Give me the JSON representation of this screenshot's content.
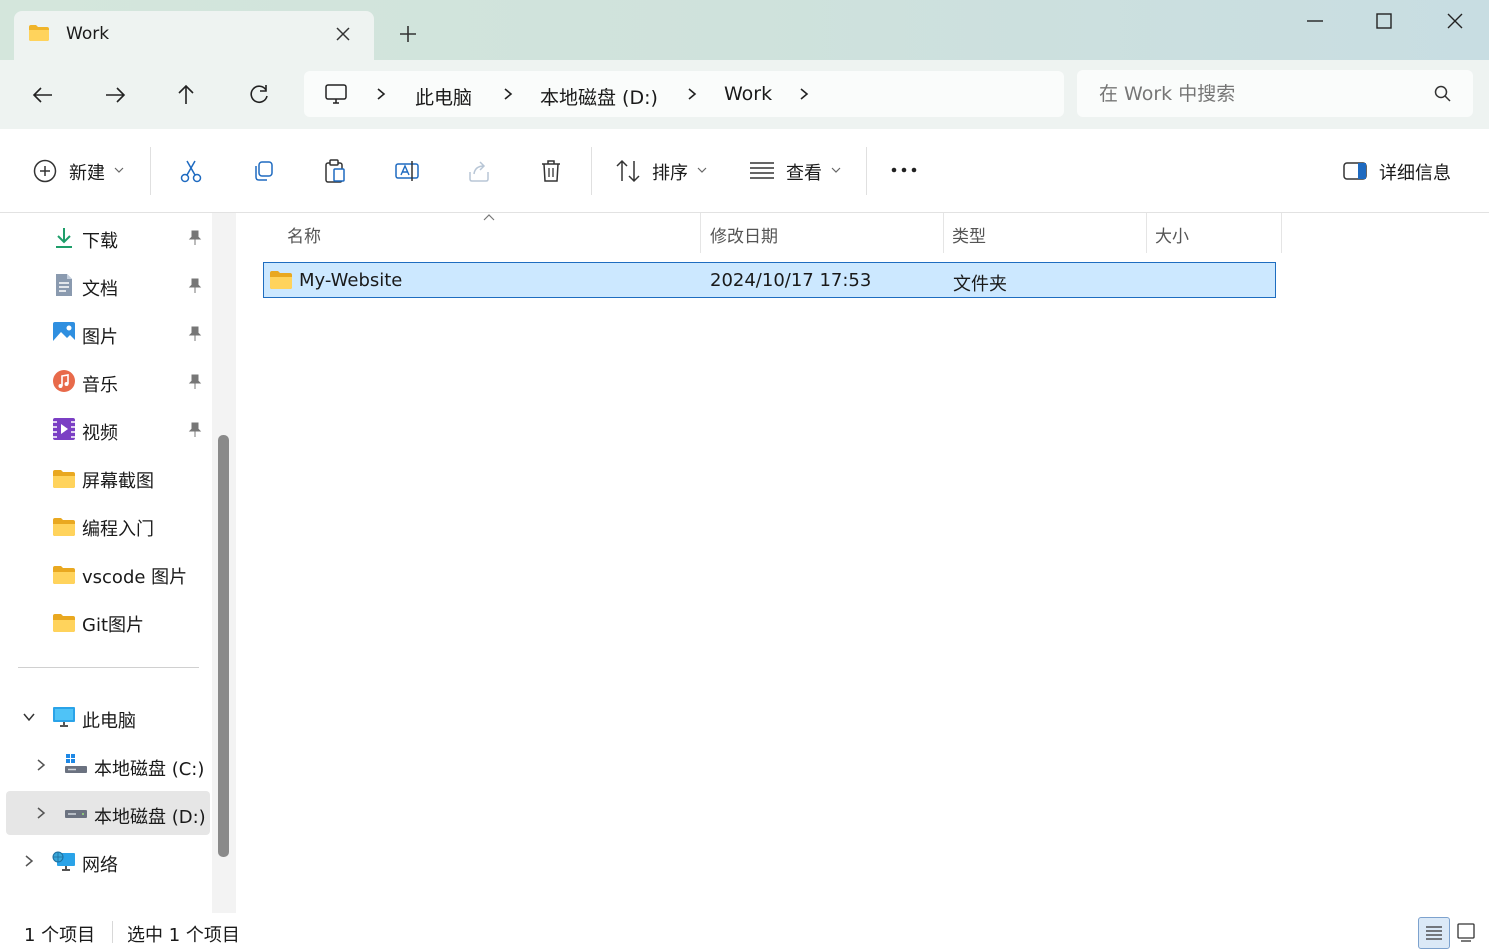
{
  "tab": {
    "title": "Work"
  },
  "address": {
    "crumbs": [
      "此电脑",
      "本地磁盘 (D:)",
      "Work"
    ]
  },
  "search": {
    "placeholder": "在 Work 中搜索"
  },
  "toolbar": {
    "new_label": "新建",
    "sort_label": "排序",
    "view_label": "查看",
    "details_label": "详细信息"
  },
  "sidebar": {
    "quick_access": [
      {
        "label": "下载",
        "icon": "download-icon",
        "pinned": true
      },
      {
        "label": "文档",
        "icon": "document-icon",
        "pinned": true
      },
      {
        "label": "图片",
        "icon": "pictures-icon",
        "pinned": true
      },
      {
        "label": "音乐",
        "icon": "music-icon",
        "pinned": true
      },
      {
        "label": "视频",
        "icon": "video-icon",
        "pinned": true
      },
      {
        "label": "屏幕截图",
        "icon": "folder-icon",
        "pinned": false
      },
      {
        "label": "编程入门",
        "icon": "folder-icon",
        "pinned": false
      },
      {
        "label": "vscode 图片",
        "icon": "folder-icon",
        "pinned": false
      },
      {
        "label": "Git图片",
        "icon": "folder-icon",
        "pinned": false
      }
    ],
    "this_pc": {
      "label": "此电脑",
      "expanded": true
    },
    "drives": [
      {
        "label": "本地磁盘 (C:)",
        "selected": false
      },
      {
        "label": "本地磁盘 (D:)",
        "selected": true
      }
    ],
    "network": {
      "label": "网络"
    }
  },
  "columns": {
    "name": "名称",
    "modified": "修改日期",
    "type": "类型",
    "size": "大小"
  },
  "files": [
    {
      "name": "My-Website",
      "modified": "2024/10/17 17:53",
      "type": "文件夹",
      "size": "",
      "selected": true
    }
  ],
  "status": {
    "count": "1 个项目",
    "selection": "选中 1 个项目"
  },
  "colors": {
    "accent": "#0067c0",
    "selection_bg": "#cce8ff",
    "selection_border": "#1e6dc0",
    "folder": "#f5c242"
  }
}
